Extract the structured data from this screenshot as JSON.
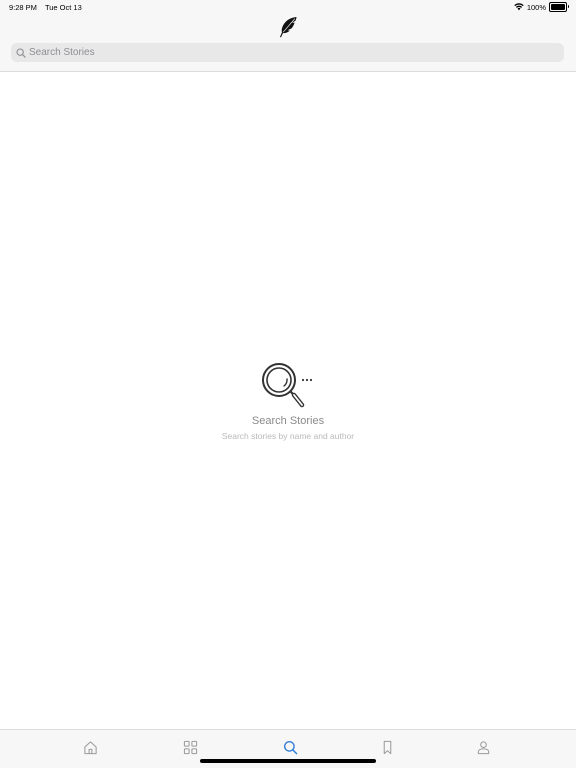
{
  "status_bar": {
    "time": "9:28 PM",
    "date": "Tue Oct 13",
    "battery": "100%",
    "wifi_icon": "wifi-icon",
    "battery_icon": "battery-icon"
  },
  "header": {
    "logo_icon": "feather-icon"
  },
  "search": {
    "placeholder": "Search Stories",
    "value": "",
    "icon": "search-icon"
  },
  "empty_state": {
    "icon": "magnifier-icon",
    "title": "Search Stories",
    "subtitle": "Search stories by name and author"
  },
  "tab_bar": {
    "tabs": [
      {
        "id": "home",
        "icon": "home-icon",
        "active": false
      },
      {
        "id": "browse",
        "icon": "grid-icon",
        "active": false
      },
      {
        "id": "search",
        "icon": "search-icon",
        "active": true
      },
      {
        "id": "bookmarks",
        "icon": "bookmark-icon",
        "active": false
      },
      {
        "id": "profile",
        "icon": "person-icon",
        "active": false
      }
    ],
    "active_color": "#2f7ed8",
    "inactive_color": "#9a9a9a"
  }
}
